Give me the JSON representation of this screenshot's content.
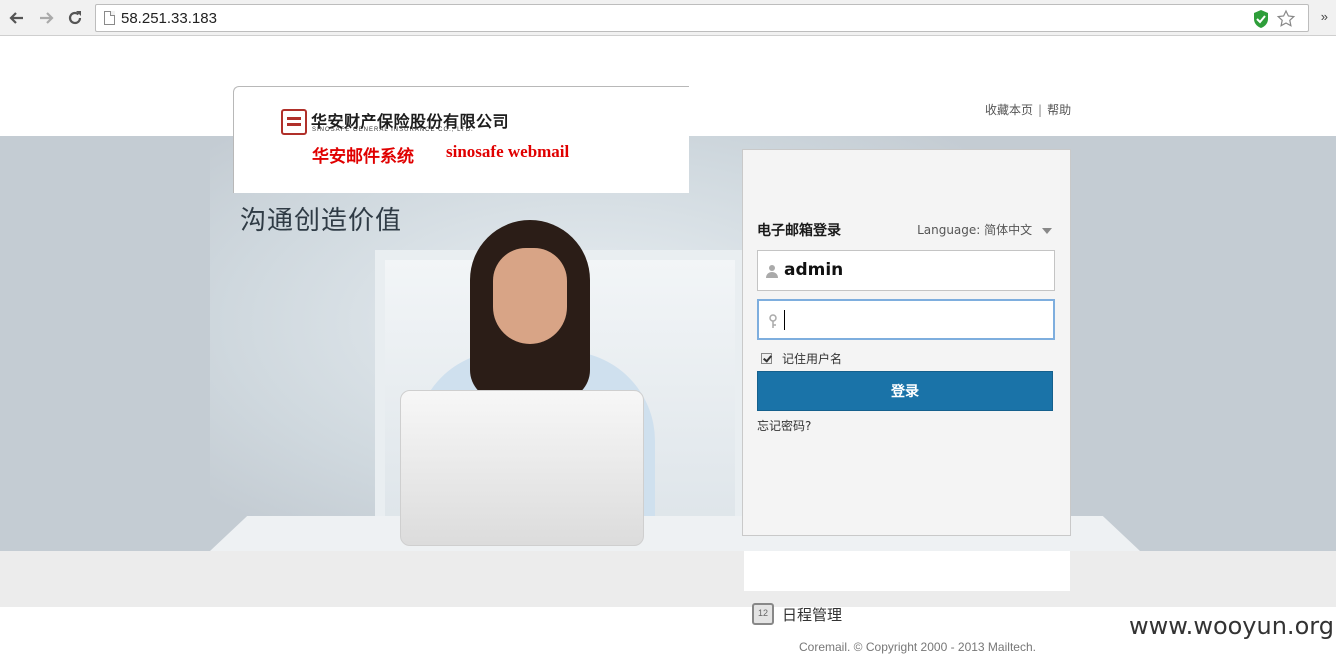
{
  "browser": {
    "url": "58.251.33.183",
    "more_label": "»"
  },
  "header": {
    "bookmark_label": "收藏本页",
    "separator": "|",
    "help_label": "帮助"
  },
  "logo": {
    "company_cn": "华安财产保险股份有限公司",
    "company_en": "SINOSAFE GENERAL INSURANCE CO., LTD.",
    "system_cn": "华安邮件系统",
    "system_en": "sinosafe webmail"
  },
  "hero": {
    "slogan": "沟通创造价值"
  },
  "login": {
    "title": "电子邮箱登录",
    "language_label": "Language:",
    "language_value": "简体中文",
    "username_value": "admin",
    "password_value": "",
    "remember_label": "记住用户名",
    "remember_checked": true,
    "submit_label": "登录",
    "forgot_label": "忘记密码?"
  },
  "features": {
    "calendar_label": "日程管理",
    "calendar_day": "12"
  },
  "footer": {
    "copyright": "Coremail. © Copyright 2000 - 2013 Mailtech."
  },
  "watermark": "www.wooyun.org",
  "colors": {
    "accent": "#1a73a8",
    "brand_red": "#e00000"
  }
}
